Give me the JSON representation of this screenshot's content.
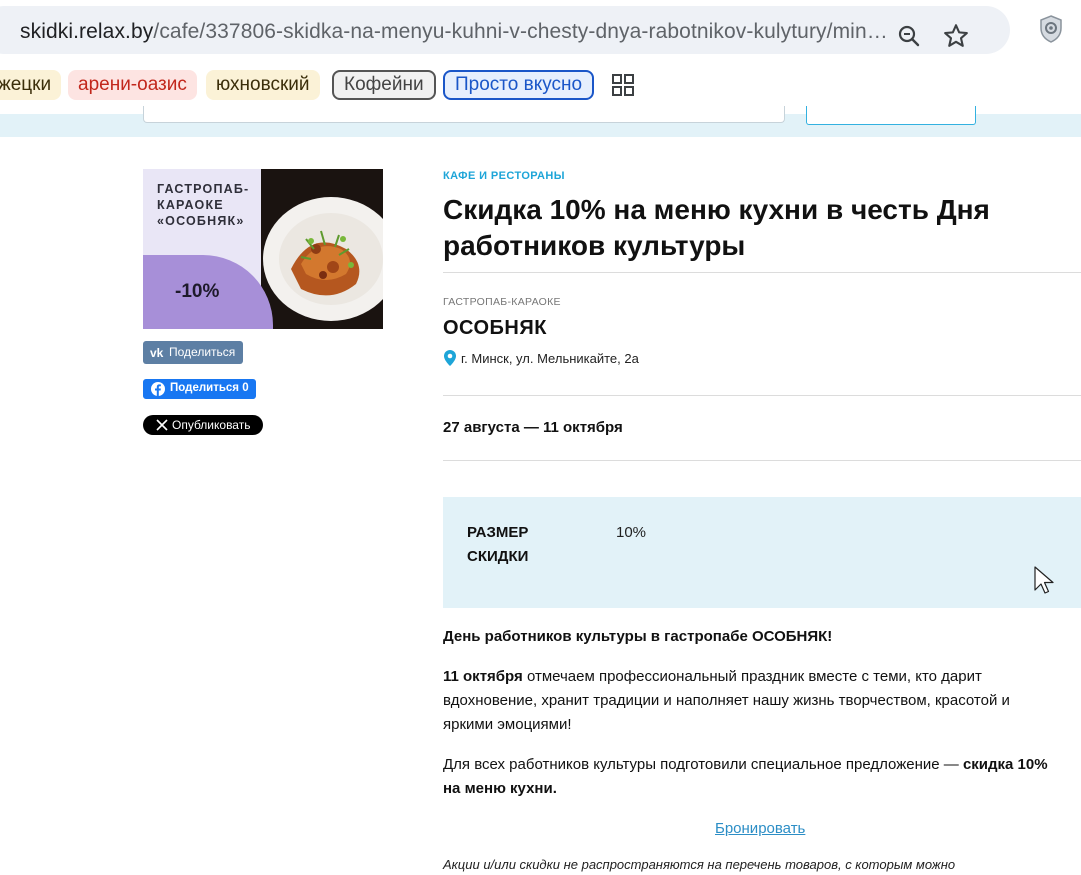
{
  "browser": {
    "url_host": "skidki.relax.by",
    "url_path": "/cafe/337806-skidka-na-menyu-kuhni-v-chesty-dnya-rabotnikov-kulytury/min…",
    "icons": [
      "site-info-icon",
      "zoom-icon",
      "star-icon",
      "extension-shield-icon"
    ]
  },
  "bookmarks": {
    "chips": [
      "жецки",
      "арени-оазис",
      "юхновский",
      "Кофейни",
      "Просто вкусно"
    ],
    "grid_icon": "apps-grid-icon"
  },
  "promo_image": {
    "lines": [
      "ГАСТРОПАБ-",
      "КАРАОКЕ",
      "«ОСОБНЯК»"
    ],
    "discount": "-10%"
  },
  "share": {
    "vk": "Поделиться",
    "fb": "Поделиться 0",
    "x": "Опубликовать"
  },
  "article": {
    "category": "КАФЕ И РЕСТОРАНЫ",
    "title": "Скидка 10% на меню кухни в честь Дня работников культуры",
    "place_type": "ГАСТРОПАБ-КАРАОКЕ",
    "place_name": "ОСОБНЯК",
    "address": "г. Минск, ул. Мельникайте, 2а",
    "dates": "27 августа — 11 октября",
    "discount_label": "РАЗМЕР СКИДКИ",
    "discount_value": "10%",
    "p1": "День работников культуры в гастропабе ОСОБНЯК!",
    "p2_bold": "11 октября",
    "p2_rest": " отмечаем профессиональный праздник вместе с теми, кто дарит вдохновение, хранит традиции и наполняет нашу жизнь творчеством, красотой и яркими эмоциями!",
    "p3_text": "Для всех работников культуры подготовили специальное предложение — ",
    "p3_bold": "скидка 10% на меню кухни.",
    "book_link": "Бронировать",
    "disclaimer": "Акции и/или скидки не распространяются на перечень товаров, с которым можно"
  },
  "colors": {
    "accent": "#1da5d8",
    "box_bg": "#e2f2f8",
    "link": "#2c8ec6",
    "promo_purple": "#a78fd8"
  }
}
